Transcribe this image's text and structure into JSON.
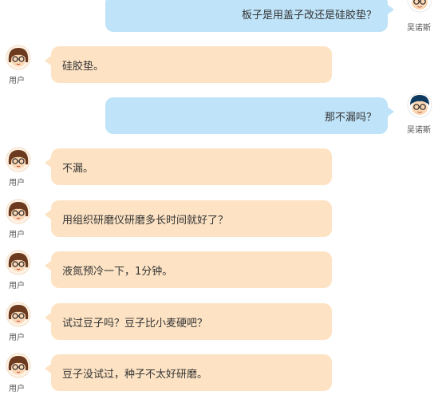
{
  "participants": {
    "user": "用户",
    "other": "吴诺斯"
  },
  "messages": [
    {
      "from": "other",
      "text": "板子是用盖子改还是硅胶垫？"
    },
    {
      "from": "user",
      "text": "硅胶垫。"
    },
    {
      "from": "other",
      "text": "那不漏吗？"
    },
    {
      "from": "user",
      "text": "不漏。"
    },
    {
      "from": "user",
      "text": "用组织研磨仪研磨多长时间就好了？"
    },
    {
      "from": "user",
      "text": "液氮预冷一下，1分钟。"
    },
    {
      "from": "user",
      "text": "试过豆子吗？豆子比小麦硬吧？"
    },
    {
      "from": "user",
      "text": "豆子没试过，种子不太好研磨。"
    }
  ],
  "colors": {
    "user_bubble": "#fde3c4",
    "other_bubble": "#bfe3f8"
  },
  "icons": {
    "user_avatar": "girl-with-glasses-avatar-icon",
    "other_avatar": "boy-with-glasses-avatar-icon"
  }
}
